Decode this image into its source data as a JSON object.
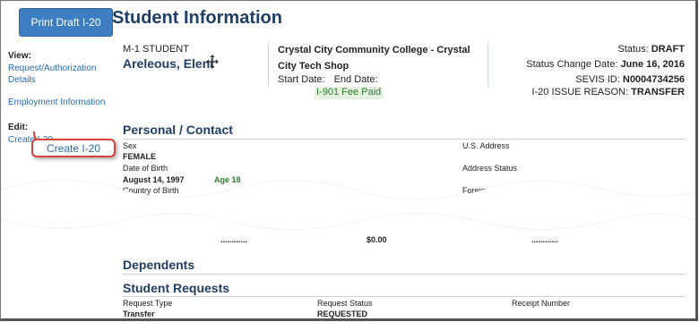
{
  "print_button": "Print Draft I-20",
  "page_title": "Student Information",
  "sidebar": {
    "view_heading": "View:",
    "links": [
      "Request/Authorization Details",
      "Employment Information"
    ],
    "edit_heading": "Edit:",
    "edit_link": "Create I-20"
  },
  "callout_label": "Create I-20",
  "student": {
    "type": "M-1 STUDENT",
    "name": "Areleous, Eleni",
    "school_line1": "Crystal City Community College - Crystal",
    "school_line2": "City Tech Shop",
    "start_date_label": "Start Date:",
    "end_date_label": "End Date:",
    "status_label": "Status:",
    "status_value": "DRAFT",
    "status_change_label": "Status Change Date:",
    "status_change_value": "June 16, 2016",
    "sevis_label": "SEVIS ID:",
    "sevis_value": "N0004734256",
    "fee_note": "I-901 Fee Paid",
    "reason_label": "I-20 ISSUE REASON:",
    "reason_value": "TRANSFER"
  },
  "personal": {
    "heading": "Personal / Contact",
    "sex_label": "Sex",
    "sex_value": "FEMALE",
    "dob_label": "Date of Birth",
    "dob_value": "August 14, 1997",
    "age": "Age 18",
    "country_label": "Country of Birth",
    "us_address_label": "U.S. Address",
    "address_status_label": "Address Status",
    "foreign_address_label": "Foreign Address"
  },
  "financial_fragment": {
    "amount": "$0.00",
    "dots": "............"
  },
  "dependents_heading": "Dependents",
  "requests": {
    "heading": "Student Requests",
    "columns": [
      "Request Type",
      "Request Status",
      "Receipt Number"
    ],
    "row": [
      "Transfer",
      "REQUESTED",
      ""
    ]
  },
  "colors": {
    "accent_blue": "#3d7ec3",
    "heading_navy": "#1f3f66",
    "link_blue": "#2b6cb0",
    "callout_red": "#d9433a",
    "fee_green": "#2e7d32"
  }
}
